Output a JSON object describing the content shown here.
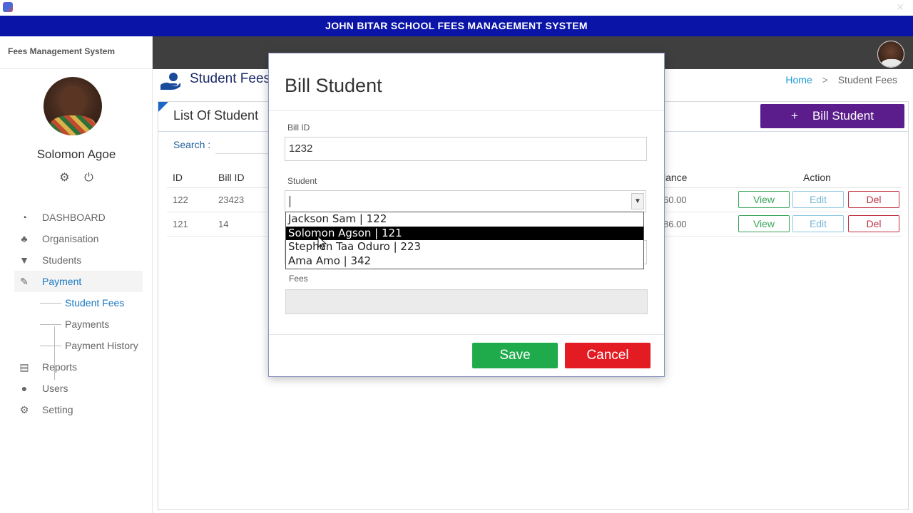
{
  "window": {
    "title": "JOHN BITAR SCHOOL FEES MANAGEMENT SYSTEM"
  },
  "sidebar": {
    "brand": "Fees Management System",
    "user_name": "Solomon Agoe",
    "items": [
      {
        "label": "DASHBOARD",
        "icon": "dashboard-icon"
      },
      {
        "label": "Organisation",
        "icon": "sitemap-icon"
      },
      {
        "label": "Students",
        "icon": "graduation-cap-icon"
      },
      {
        "label": "Payment",
        "icon": "payment-icon"
      },
      {
        "label": "Reports",
        "icon": "clipboard-icon"
      },
      {
        "label": "Users",
        "icon": "user-icon"
      },
      {
        "label": "Setting",
        "icon": "gear-icon"
      }
    ],
    "payment_sub": [
      {
        "label": "Student Fees"
      },
      {
        "label": "Payments"
      },
      {
        "label": "Payment History"
      }
    ]
  },
  "page": {
    "title": "Student Fees",
    "breadcrumb_home": "Home",
    "breadcrumb_sep": ">",
    "breadcrumb_current": "Student Fees"
  },
  "panel": {
    "title": "List Of Student",
    "bill_button_plus": "+",
    "bill_button_label": "Bill Student",
    "search_label": "Search :",
    "columns": {
      "id": "ID",
      "bill_id": "Bill ID",
      "balance": "lance",
      "action": "Action"
    },
    "rows": [
      {
        "id": "122",
        "bill_id": "23423",
        "balance": "60.00"
      },
      {
        "id": "121",
        "bill_id": "14",
        "balance": "86.00"
      }
    ],
    "view_label": "View",
    "edit_label": "Edit",
    "del_label": "Del"
  },
  "modal": {
    "title": "Bill Student",
    "bill_id_label": "Bill ID",
    "bill_id_value": "1232",
    "student_label": "Student",
    "student_value": "",
    "fees_label": "Fees",
    "fees_value": "",
    "save_label": "Save",
    "cancel_label": "Cancel",
    "options": [
      {
        "label": "Jackson Sam | 122",
        "selected": false
      },
      {
        "label": "Solomon Agson | 121",
        "selected": true
      },
      {
        "label": "Stephen Taa Oduro | 223",
        "selected": false
      },
      {
        "label": "Ama Amo | 342",
        "selected": false
      }
    ]
  },
  "colors": {
    "header": "#0a14a6",
    "accent_blue": "#1a78c2",
    "bill_button": "#5b1d8c",
    "save": "#1fab4b",
    "cancel": "#e31b23"
  }
}
